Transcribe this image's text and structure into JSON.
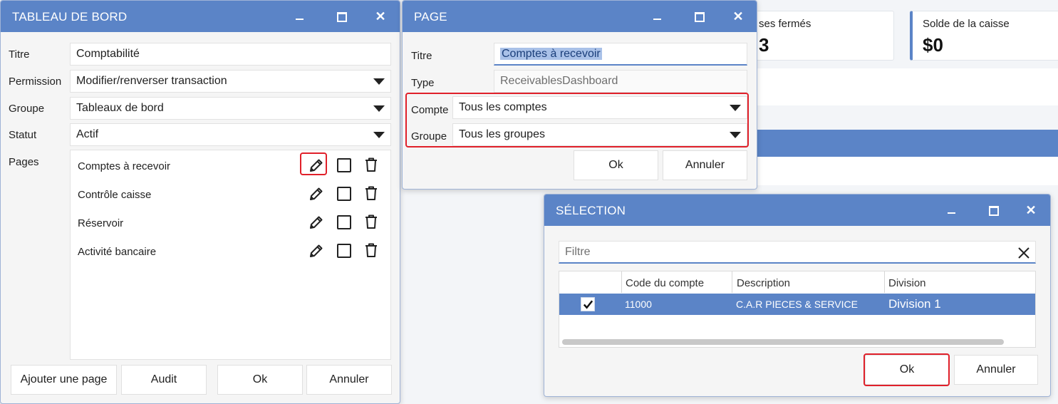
{
  "background": {
    "card_left_label": "ses fermés",
    "card_left_value": "3",
    "card_right_label": "Solde de la caisse",
    "card_right_value": "$0",
    "accent_color": "#5b84c7"
  },
  "tableau": {
    "title": "TABLEAU DE BORD",
    "titre_label": "Titre",
    "titre_value": "Comptabilité",
    "permission_label": "Permission",
    "permission_value": "Modifier/renverser transaction",
    "groupe_label": "Groupe",
    "groupe_value": "Tableaux de bord",
    "statut_label": "Statut",
    "statut_value": "Actif",
    "pages_label": "Pages",
    "pages": [
      {
        "label": "Comptes à recevoir"
      },
      {
        "label": "Contrôle caisse"
      },
      {
        "label": "Réservoir"
      },
      {
        "label": "Activité bancaire"
      }
    ],
    "buttons": {
      "add_page": "Ajouter une page",
      "audit": "Audit",
      "ok": "Ok",
      "cancel": "Annuler"
    },
    "window_controls": {
      "close": "✕"
    }
  },
  "page_dialog": {
    "title": "PAGE",
    "titre_label": "Titre",
    "titre_value": "Comptes à recevoir",
    "type_label": "Type",
    "type_value": "ReceivablesDashboard",
    "compte_label": "Compte",
    "compte_value": "Tous les comptes",
    "groupe_label": "Groupe",
    "groupe_value": "Tous les groupes",
    "buttons": {
      "ok": "Ok",
      "cancel": "Annuler"
    },
    "window_controls": {
      "close": "✕"
    }
  },
  "selection": {
    "title": "SÉLECTION",
    "filter_placeholder": "Filtre",
    "columns": [
      "Code du compte",
      "Description",
      "Division"
    ],
    "rows": [
      {
        "checked": true,
        "code": "11000",
        "description": "C.A.R PIECES & SERVICE",
        "division": "Division 1"
      }
    ],
    "buttons": {
      "ok": "Ok",
      "cancel": "Annuler"
    },
    "window_controls": {
      "close": "✕"
    }
  },
  "icons": {
    "edit": "pencil-icon",
    "select": "checkbox-icon",
    "delete": "trash-icon",
    "clear": "close-icon",
    "check": "checkmark-icon"
  },
  "highlight_color": "#e0202a"
}
